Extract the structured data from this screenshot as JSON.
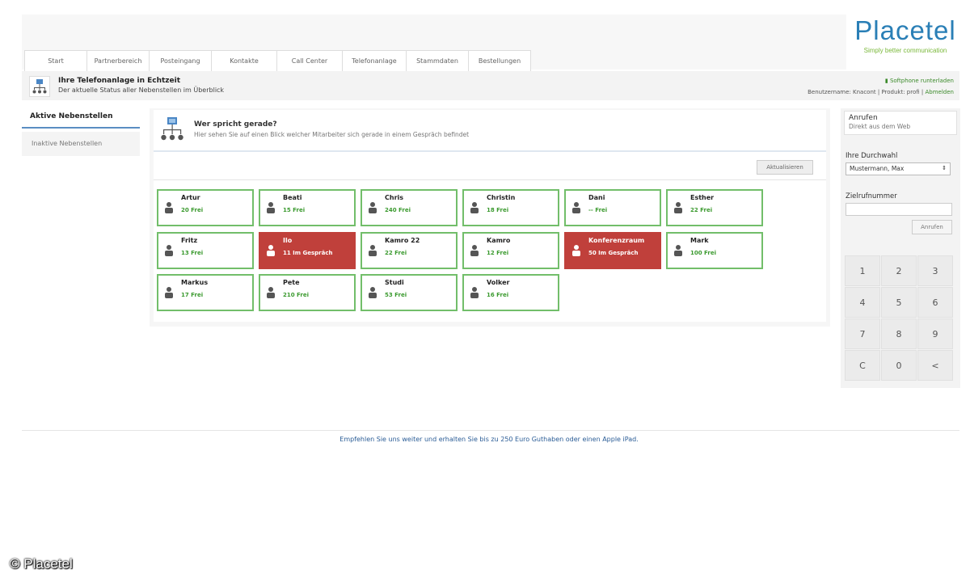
{
  "brand": {
    "logo": "Placetel",
    "tagline": "Simply better communication",
    "logo_color": "#2a7fb6",
    "tagline_color": "#7ab83a"
  },
  "tabs": [
    "Start",
    "Partnerbereich",
    "Posteingang",
    "Kontakte",
    "Call Center",
    "Telefonanlage",
    "Stammdaten",
    "Bestellungen"
  ],
  "header": {
    "title": "Ihre Telefonanlage in Echtzeit",
    "subtitle": "Der aktuelle Status aller Nebenstellen im Überblick",
    "softphone_link": "Softphone runterladen",
    "user_info": "Benutzername: Knacont | Produkt: profi |",
    "logout_link": "Abmelden"
  },
  "left_nav": {
    "active": "Aktive Nebenstellen",
    "inactive": "Inaktive Nebenstellen"
  },
  "panel": {
    "title": "Wer spricht gerade?",
    "subtitle": "Hier sehen Sie auf einen Blick welcher Mitarbeiter sich gerade in einem Gespräch befindet",
    "update_button": "Aktualisieren"
  },
  "extensions": [
    {
      "name": "Artur",
      "status": "20 Frei",
      "busy": false
    },
    {
      "name": "Beati",
      "status": "15 Frei",
      "busy": false
    },
    {
      "name": "Chris",
      "status": "240 Frei",
      "busy": false
    },
    {
      "name": "Christin",
      "status": "18 Frei",
      "busy": false
    },
    {
      "name": "Dani",
      "status": "-- Frei",
      "busy": false
    },
    {
      "name": "Esther",
      "status": "22 Frei",
      "busy": false
    },
    {
      "name": "Fritz",
      "status": "13 Frei",
      "busy": false
    },
    {
      "name": "Ilo",
      "status": "11 Im Gespräch",
      "busy": true
    },
    {
      "name": "Kamro 22",
      "status": "22 Frei",
      "busy": false
    },
    {
      "name": "Kamro",
      "status": "12 Frei",
      "busy": false
    },
    {
      "name": "Konferenzraum",
      "status": "50 Im Gespräch",
      "busy": true
    },
    {
      "name": "Mark",
      "status": "100 Frei",
      "busy": false
    },
    {
      "name": "Markus",
      "status": "17 Frei",
      "busy": false
    },
    {
      "name": "Pete",
      "status": "210 Frei",
      "busy": false
    },
    {
      "name": "Studi",
      "status": "53 Frei",
      "busy": false
    },
    {
      "name": "Volker",
      "status": "16 Frei",
      "busy": false
    }
  ],
  "status_colors": {
    "free_border": "#72be6a",
    "busy_bg": "#c0403b"
  },
  "call": {
    "title": "Anrufen",
    "subtitle": "Direkt aus dem Web",
    "extension_label": "Ihre Durchwahl",
    "extension_value": "Mustermann, Max",
    "target_label": "Zielrufnummer",
    "call_button": "Anrufen"
  },
  "keypad": [
    "1",
    "2",
    "3",
    "4",
    "5",
    "6",
    "7",
    "8",
    "9",
    "C",
    "0",
    "<"
  ],
  "footer": "Empfehlen Sie uns weiter und erhalten Sie bis zu 250 Euro Guthaben oder einen Apple iPad.",
  "copyright": "© Placetel"
}
